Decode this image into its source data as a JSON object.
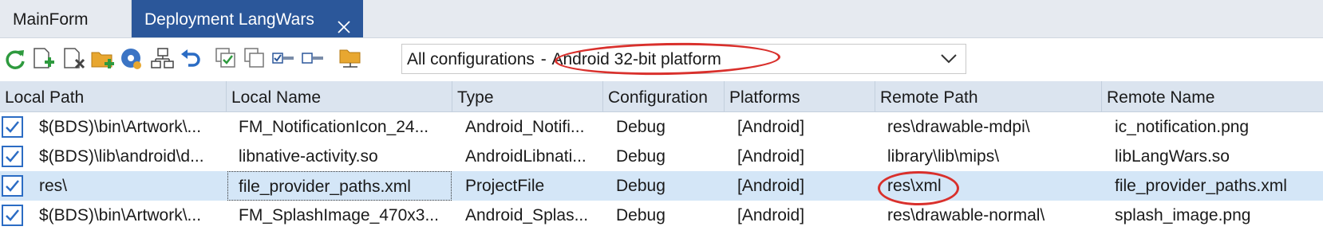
{
  "tabs": [
    {
      "label": "MainForm",
      "active": false
    },
    {
      "label": "Deployment LangWars",
      "active": true
    }
  ],
  "toolbar": {
    "icons": [
      "refresh-icon",
      "add-file-icon",
      "remove-file-icon",
      "add-folder-icon",
      "deploy-disc-icon",
      "network-icon",
      "revert-icon",
      "select-all-icon",
      "unselect-all-icon",
      "collapse-icon",
      "expand-icon",
      "folder-network-icon"
    ],
    "config_select": {
      "configuration": "All configurations",
      "separator": "-",
      "platform": "Android 32-bit platform"
    }
  },
  "grid": {
    "columns": [
      "Local Path",
      "Local Name",
      "Type",
      "Configuration",
      "Platforms",
      "Remote Path",
      "Remote Name"
    ],
    "rows": [
      {
        "checked": true,
        "local_path": "$(BDS)\\bin\\Artwork\\...",
        "local_name": "FM_NotificationIcon_24...",
        "type": "Android_Notifi...",
        "configuration": "Debug",
        "platforms": "[Android]",
        "remote_path": "res\\drawable-mdpi\\",
        "remote_name": "ic_notification.png"
      },
      {
        "checked": true,
        "local_path": "$(BDS)\\lib\\android\\d...",
        "local_name": "libnative-activity.so",
        "type": "AndroidLibnati...",
        "configuration": "Debug",
        "platforms": "[Android]",
        "remote_path": "library\\lib\\mips\\",
        "remote_name": "libLangWars.so"
      },
      {
        "checked": true,
        "local_path": "res\\",
        "local_name": "file_provider_paths.xml",
        "type": "ProjectFile",
        "configuration": "Debug",
        "platforms": "[Android]",
        "remote_path": "res\\xml",
        "remote_name": "file_provider_paths.xml",
        "selected": true
      },
      {
        "checked": true,
        "local_path": "$(BDS)\\bin\\Artwork\\...",
        "local_name": "FM_SplashImage_470x3...",
        "type": "Android_Splas...",
        "configuration": "Debug",
        "platforms": "[Android]",
        "remote_path": "res\\drawable-normal\\",
        "remote_name": "splash_image.png"
      }
    ]
  },
  "colors": {
    "tab_active": "#2b579a",
    "header_bg": "#dbe4ef",
    "selected_row": "#d4e6f7",
    "checkbox": "#2b6cc4",
    "annotation": "#d9302c"
  }
}
